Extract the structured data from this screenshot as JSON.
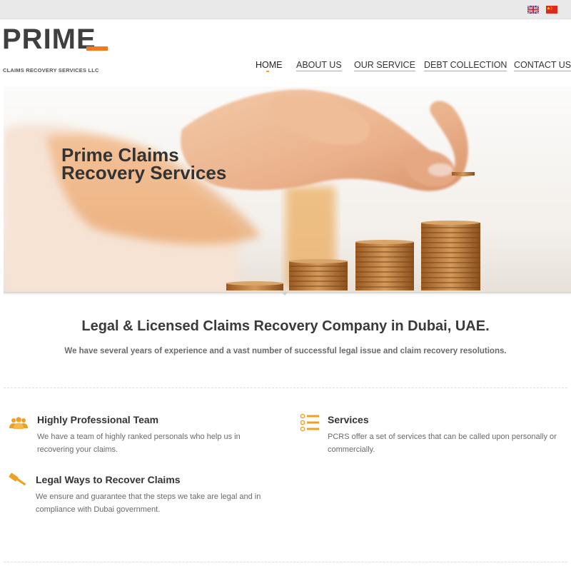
{
  "colors": {
    "accent": "#f0a020",
    "logo_orange": "#f47a1f",
    "text_dark": "#333333"
  },
  "topbar": {
    "flags": [
      "uk-flag-icon",
      "china-flag-icon"
    ]
  },
  "logo": {
    "word": "PRIME",
    "subtitle": "CLAIMS RECOVERY SERVICES LLC"
  },
  "nav": {
    "items": [
      {
        "label": "HOME",
        "active": true
      },
      {
        "label": "ABOUT US"
      },
      {
        "label": "OUR SERVICE"
      },
      {
        "label": "DEBT COLLECTION"
      },
      {
        "label": "CONTACT US"
      }
    ]
  },
  "hero": {
    "title_line1": "Prime Claims",
    "title_line2": "Recovery Services"
  },
  "main": {
    "tagline": "Legal & Licensed Claims Recovery Company in Dubai, UAE.",
    "intro": "We have several years of experience and a vast number of successful legal issue and claim recovery resolutions."
  },
  "features": [
    {
      "icon": "team-icon",
      "title": "Highly Professional Team",
      "desc": "We have a team of highly ranked personals who help us in recovering your claims."
    },
    {
      "icon": "list-icon",
      "title": "Services",
      "desc": "PCRS offer a set of services that can be called upon personally or commercially."
    },
    {
      "icon": "gavel-icon",
      "title": "Legal Ways to Recover Claims",
      "desc": "We ensure and guarantee that the steps we take are legal and in compliance with Dubai government."
    }
  ]
}
